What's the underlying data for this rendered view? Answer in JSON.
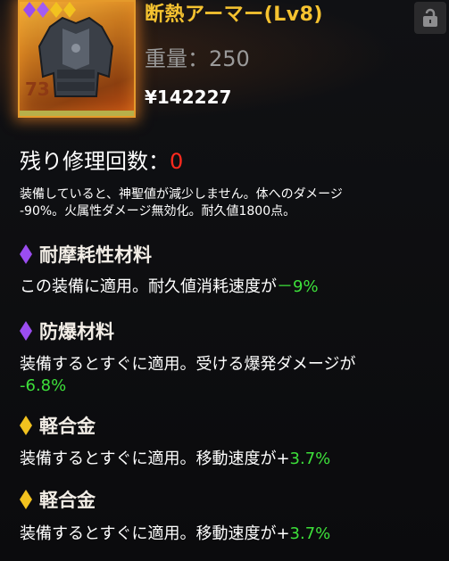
{
  "item": {
    "name": "断熱アーマー(Lv8)",
    "weight": "重量：250",
    "price": "¥142227",
    "level": "73"
  },
  "repair": {
    "label": "残り修理回数：",
    "count": "0"
  },
  "description": {
    "line1": "装備していると、神聖値が減少しません。体へのダメージ",
    "line2": "-90%。火属性ダメージ無効化。耐久値1800点。"
  },
  "mods": [
    {
      "title": "耐摩耗性材料",
      "gem_color": "#9b4df0",
      "text_prefix": "この装備に適用。耐久値消耗速度が",
      "value": "－9%",
      "text_suffix": ""
    },
    {
      "title": "防爆材料",
      "gem_color": "#9b4df0",
      "text_prefix": "装備するとすぐに適用。受ける爆発ダメージが",
      "value": "-6.8%",
      "text_suffix": ""
    },
    {
      "title": "軽合金",
      "gem_color": "#f2c21f",
      "text_prefix": "装備するとすぐに適用。移動速度が+",
      "value": "3.7%",
      "text_suffix": ""
    },
    {
      "title": "軽合金",
      "gem_color": "#f2c21f",
      "text_prefix": "装備するとすぐに適用。移動速度が+",
      "value": "3.7%",
      "text_suffix": ""
    }
  ],
  "icons": {
    "lock": "lock-icon",
    "armor": "armor-icon",
    "gem": "gem-icon"
  },
  "colors": {
    "title": "#f6c330",
    "value_green": "#3de03a",
    "repair_count": "#ff2a1e",
    "purple_gem": "#9b4df0",
    "gold_gem": "#f2c21f"
  }
}
